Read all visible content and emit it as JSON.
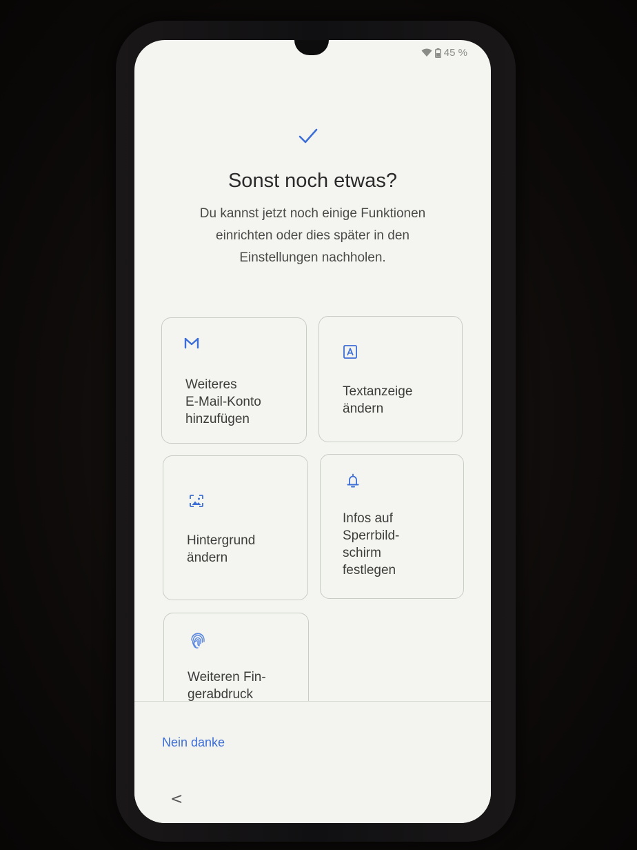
{
  "status": {
    "battery": "45 %",
    "icons": [
      "wifi-icon",
      "battery-icon"
    ]
  },
  "header": {
    "icon": "check-icon",
    "title": "Sonst noch etwas?",
    "subtitle_lines": [
      "Du kannst jetzt noch einige Funktionen",
      "einrichten oder dies später in den",
      "Einstellungen nachholen."
    ]
  },
  "options": [
    {
      "icon": "mail-icon",
      "label": "Weiteres\nE-Mail-Konto\nhinzufügen"
    },
    {
      "icon": "text-display-icon",
      "label": "Textanzeige\nändern"
    },
    {
      "icon": "wallpaper-icon",
      "label": "Hintergrund\nändern"
    },
    {
      "icon": "bell-icon",
      "label": "Infos auf\nSperrbild-\nschirm\nfestlegen"
    },
    {
      "icon": "fingerprint-icon",
      "label": "Weiteren Fin-\ngerabdruck"
    }
  ],
  "footer": {
    "skip_label": "Nein danke",
    "back_label": "<"
  },
  "colors": {
    "accent": "#3d6ed6",
    "screen_bg": "#f4f5f0",
    "text": "#2a2a2a",
    "card_border": "#c9cbc5"
  }
}
